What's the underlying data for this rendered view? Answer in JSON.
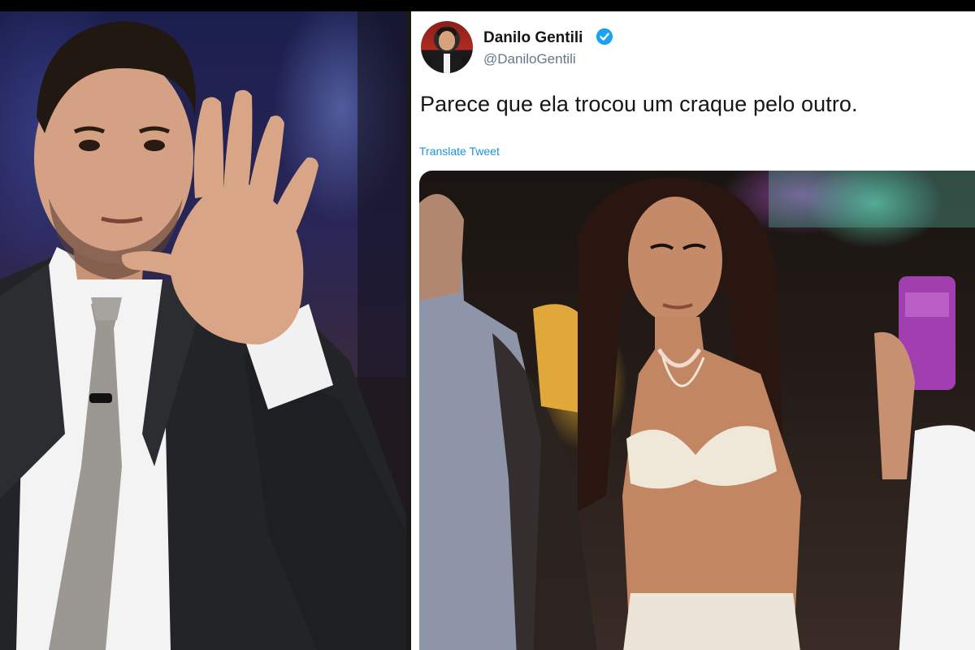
{
  "tweet": {
    "display_name": "Danilo Gentili",
    "handle": "@DaniloGentili",
    "text": "Parece que ela trocou um craque pelo outro.",
    "translate_label": "Translate Tweet",
    "verified_icon": "verified-badge-icon"
  },
  "colors": {
    "link": "#1b95e0",
    "verified": "#1da1f2",
    "text": "#14171a",
    "secondary": "#657786"
  }
}
